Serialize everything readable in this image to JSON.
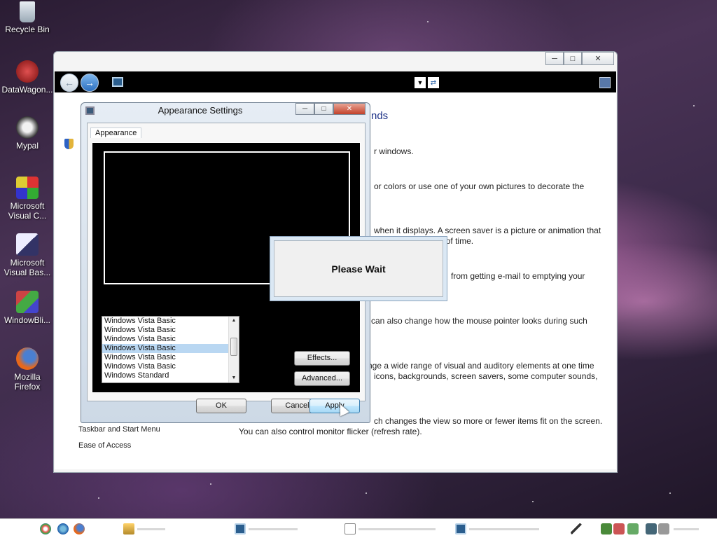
{
  "desktop": {
    "icons": [
      {
        "label": "Recycle Bin"
      },
      {
        "label": "DataWagon..."
      },
      {
        "label": "Mypal"
      },
      {
        "label": "Microsoft Visual C..."
      },
      {
        "label": "Microsoft Visual Bas..."
      },
      {
        "label": "WindowBli..."
      },
      {
        "label": "Mozilla Firefox"
      }
    ]
  },
  "control_panel": {
    "heading_fragment": "nds",
    "side_links": [
      "Taskbar and Start Menu",
      "Ease of Access"
    ],
    "texts": [
      "r windows.",
      "or colors or use one of your own pictures to decorate the",
      "when it displays. A screen saver is a picture or animation that",
      "dle for a set period of time.",
      "from getting e-mail to emptying your",
      "can also change how the mouse pointer looks during such",
      "nge a wide range of visual and auditory elements at one time",
      "icons, backgrounds, screen savers, some computer sounds,",
      "ch changes the view so more or fewer items fit on the screen.",
      "You can also control monitor flicker (refresh rate)."
    ]
  },
  "appearance_dialog": {
    "title": "Appearance Settings",
    "tab_label": "Appearance",
    "schemes": [
      "Windows Vista Basic",
      "Windows Vista Basic",
      "Windows Vista Basic",
      "Windows Vista Basic",
      "Windows Vista Basic",
      "Windows Vista Basic",
      "Windows Standard"
    ],
    "selected_index": 3,
    "effects_label": "Effects...",
    "advanced_label": "Advanced...",
    "ok_label": "OK",
    "cancel_label": "Cancel",
    "apply_label": "Apply"
  },
  "please_wait": {
    "message": "Please Wait"
  },
  "colors": {
    "link_blue": "#1e3287",
    "selection": "#b9d7f2",
    "panel_black": "#000000"
  }
}
